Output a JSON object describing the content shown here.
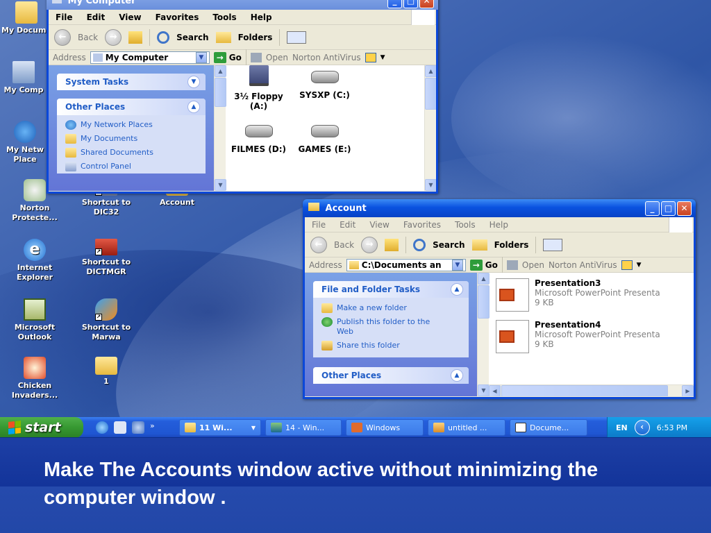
{
  "desktop": {
    "icons": [
      {
        "label": "My Docume",
        "icon": "folder-documents-icon"
      },
      {
        "label": "My Comp",
        "icon": "computer-icon"
      },
      {
        "label": "My Netw Place",
        "icon": "network-places-icon"
      },
      {
        "label": "Norton Protecte...",
        "icon": "norton-icon"
      },
      {
        "label": "Shortcut to DIC32",
        "icon": "shortcut-icon"
      },
      {
        "label": "Account",
        "icon": "folder-icon"
      },
      {
        "label": "Internet Explorer",
        "icon": "internet-explorer-icon"
      },
      {
        "label": "Shortcut to DICTMGR",
        "icon": "shortcut-icon"
      },
      {
        "label": "Microsoft Outlook",
        "icon": "outlook-icon"
      },
      {
        "label": "Shortcut to Marwa",
        "icon": "shortcut-icon"
      },
      {
        "label": "Chicken Invaders...",
        "icon": "chicken-invaders-icon"
      },
      {
        "label": "1",
        "icon": "folder-icon"
      }
    ]
  },
  "my_computer": {
    "title": "My Computer",
    "menu": [
      "File",
      "Edit",
      "View",
      "Favorites",
      "Tools",
      "Help"
    ],
    "toolbar": {
      "back": "Back",
      "search": "Search",
      "folders": "Folders"
    },
    "address": {
      "label": "Address",
      "value": "My Computer",
      "go": "Go",
      "open": "Open",
      "norton": "Norton AntiVirus"
    },
    "system_tasks": "System Tasks",
    "other_places": {
      "title": "Other Places",
      "items": [
        "My Network Places",
        "My Documents",
        "Shared Documents",
        "Control Panel"
      ]
    },
    "drives": [
      {
        "label": "3½ Floppy (A:)"
      },
      {
        "label": "SYSXP (C:)"
      },
      {
        "label": "FILMES (D:)"
      },
      {
        "label": "GAMES (E:)"
      }
    ]
  },
  "account": {
    "title": "Account",
    "menu": [
      "File",
      "Edit",
      "View",
      "Favorites",
      "Tools",
      "Help"
    ],
    "toolbar": {
      "back": "Back",
      "search": "Search",
      "folders": "Folders"
    },
    "address": {
      "label": "Address",
      "value": "C:\\Documents an",
      "go": "Go",
      "open": "Open",
      "norton": "Norton AntiVirus"
    },
    "tasks": {
      "title": "File and Folder Tasks",
      "items": [
        "Make a new folder",
        "Publish this folder to the Web",
        "Share this folder"
      ]
    },
    "other_places": "Other Places",
    "files": [
      {
        "name": "Presentation3",
        "type": "Microsoft PowerPoint Presenta",
        "size": "9 KB"
      },
      {
        "name": "Presentation4",
        "type": "Microsoft PowerPoint Presenta",
        "size": "9 KB"
      }
    ]
  },
  "taskbar": {
    "start": "start",
    "more": "»",
    "tasks": [
      "11 Wi...",
      "14 - Win...",
      "Windows",
      "untitled ...",
      "Docume..."
    ],
    "lang": "EN",
    "time": "6:53 PM"
  },
  "caption": "Make The Accounts window active without minimizing the computer window ."
}
